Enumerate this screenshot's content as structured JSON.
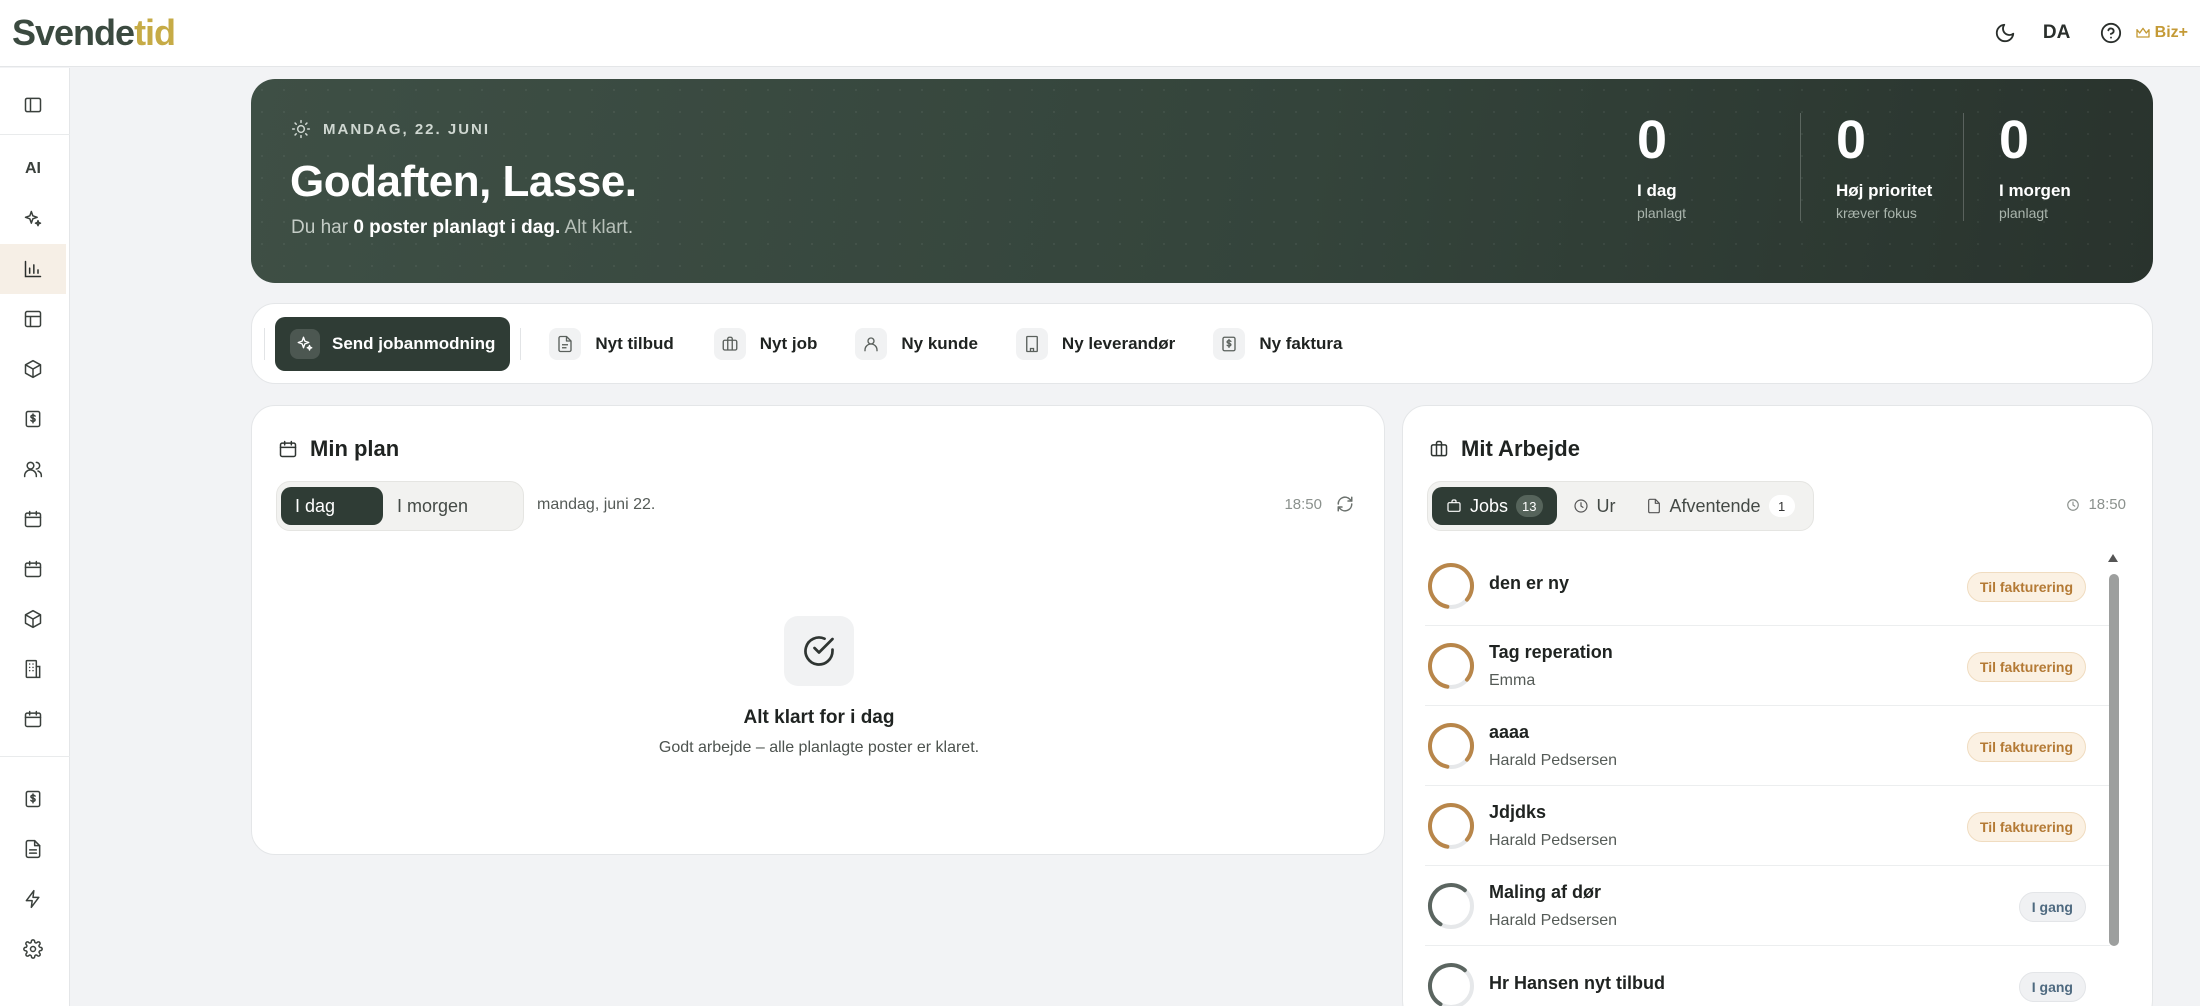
{
  "header": {
    "logo_part1": "Svende",
    "logo_part2": "tid",
    "lang": "DA",
    "plan_badge": "Biz+"
  },
  "sidebar": {
    "ai_label": "AI",
    "items": [
      "sidebar-toggle-icon",
      "ai",
      "sparkle-icon",
      "chart-icon",
      "layout-icon",
      "package-icon",
      "invoice-icon",
      "users-icon",
      "calendar-icon",
      "calendar-icon",
      "package-icon",
      "building-icon",
      "calendar-icon",
      "invoice-icon",
      "document-icon",
      "bolt-icon",
      "gear-icon"
    ]
  },
  "hero": {
    "date": "MANDAG, 22. JUNI",
    "greeting": "Godaften, Lasse.",
    "sub_prefix": "Du har",
    "sub_bold": "0 poster planlagt i dag.",
    "sub_suffix": "Alt klart.",
    "stats": [
      {
        "value": "0",
        "label": "I dag",
        "sub": "planlagt"
      },
      {
        "value": "0",
        "label": "Høj prioritet",
        "sub": "kræver fokus"
      },
      {
        "value": "0",
        "label": "I morgen",
        "sub": "planlagt"
      }
    ]
  },
  "actions": {
    "primary": "Send jobanmodning",
    "items": [
      "Nyt tilbud",
      "Nyt job",
      "Ny kunde",
      "Ny leverandør",
      "Ny faktura"
    ]
  },
  "plan": {
    "title": "Min plan",
    "tabs": [
      "I dag",
      "I morgen"
    ],
    "date": "mandag, juni 22.",
    "time": "18:50",
    "empty_title": "Alt klart for i dag",
    "empty_sub": "Godt arbejde – alle planlagte poster er klaret."
  },
  "work": {
    "title": "Mit Arbejde",
    "tabs": [
      {
        "label": "Jobs",
        "count": "13"
      },
      {
        "label": "Ur"
      },
      {
        "label": "Afventende",
        "count": "1"
      }
    ],
    "time": "18:50",
    "jobs": [
      {
        "title": "den er ny",
        "sub": "",
        "status": "Til fakturering",
        "kind": "inv"
      },
      {
        "title": "Tag reperation",
        "sub": "Emma",
        "status": "Til fakturering",
        "kind": "inv"
      },
      {
        "title": "aaaa",
        "sub": "Harald Pedsersen",
        "status": "Til fakturering",
        "kind": "inv"
      },
      {
        "title": "Jdjdks",
        "sub": "Harald Pedsersen",
        "status": "Til fakturering",
        "kind": "inv"
      },
      {
        "title": "Maling af dør",
        "sub": "Harald Pedsersen",
        "status": "I gang",
        "kind": "go"
      },
      {
        "title": "Hr Hansen nyt tilbud",
        "sub": "",
        "status": "I gang",
        "kind": "go"
      }
    ]
  },
  "colors": {
    "brand_dark": "#2f3c35",
    "brand_gold": "#c6ab46",
    "ring_invoice": "#b8864a",
    "ring_progress": "#5b6560"
  }
}
